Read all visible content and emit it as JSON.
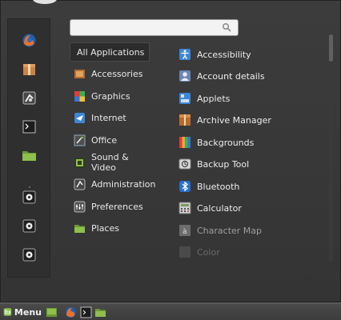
{
  "search": {
    "value": "",
    "placeholder": ""
  },
  "favorites": [
    {
      "name": "firefox-icon"
    },
    {
      "name": "software-manager-icon"
    },
    {
      "name": "system-settings-icon"
    },
    {
      "name": "terminal-icon"
    },
    {
      "name": "files-icon"
    },
    {
      "name": "lock-screen-icon"
    },
    {
      "name": "logout-icon"
    },
    {
      "name": "quit-icon"
    }
  ],
  "categories": [
    {
      "label": "All Applications",
      "icon": "",
      "selected": true
    },
    {
      "label": "Accessories",
      "icon": "accessories-icon"
    },
    {
      "label": "Graphics",
      "icon": "graphics-icon"
    },
    {
      "label": "Internet",
      "icon": "internet-icon"
    },
    {
      "label": "Office",
      "icon": "office-icon"
    },
    {
      "label": "Sound & Video",
      "icon": "sound-video-icon"
    },
    {
      "label": "Administration",
      "icon": "administration-icon"
    },
    {
      "label": "Preferences",
      "icon": "preferences-icon"
    },
    {
      "label": "Places",
      "icon": "places-folder-icon"
    }
  ],
  "apps": [
    {
      "label": "Accessibility",
      "icon": "accessibility-icon"
    },
    {
      "label": "Account details",
      "icon": "account-details-icon"
    },
    {
      "label": "Applets",
      "icon": "applets-icon"
    },
    {
      "label": "Archive Manager",
      "icon": "archive-manager-icon"
    },
    {
      "label": "Backgrounds",
      "icon": "backgrounds-icon"
    },
    {
      "label": "Backup Tool",
      "icon": "backup-tool-icon"
    },
    {
      "label": "Bluetooth",
      "icon": "bluetooth-icon"
    },
    {
      "label": "Calculator",
      "icon": "calculator-icon"
    },
    {
      "label": "Character Map",
      "icon": "character-map-icon"
    },
    {
      "label": "Color",
      "icon": "color-icon"
    }
  ],
  "taskbar": {
    "menu_label": "Menu",
    "icons": [
      "show-desktop-icon",
      "firefox-icon",
      "terminal-icon",
      "files-icon"
    ]
  },
  "colors": {
    "accent_green": "#8fbf4d",
    "panel_bg": "#3c3c3c",
    "dark_bg": "#2f2f2f"
  }
}
